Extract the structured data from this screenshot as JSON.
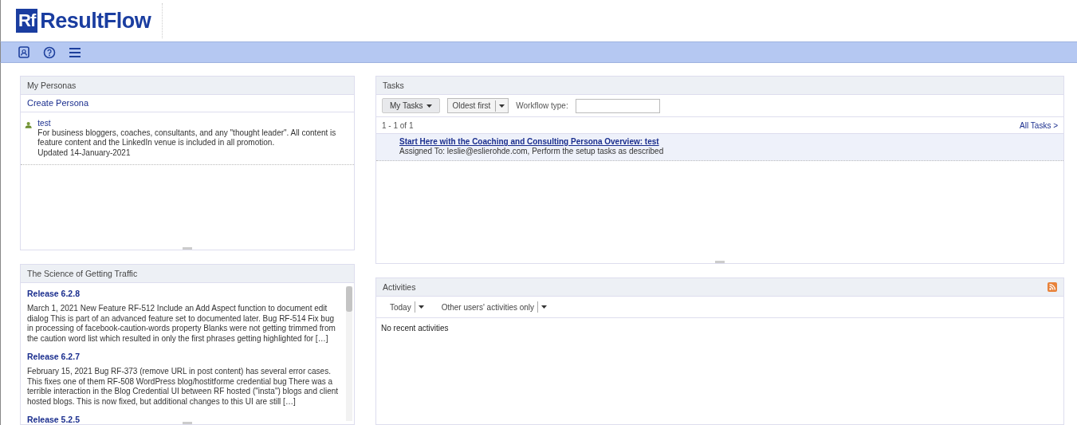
{
  "header": {
    "logo_mark": "Rf",
    "logo_text": "ResultFlow"
  },
  "toolbar": {
    "icons": [
      {
        "kind": "account"
      },
      {
        "kind": "help"
      },
      {
        "kind": "menu"
      }
    ]
  },
  "personas": {
    "title": "My Personas",
    "create_link": "Create Persona",
    "items": [
      {
        "name": "test",
        "description": "For business bloggers, coaches, consultants, and any \"thought leader\". All content is feature content and the LinkedIn venue is included in all promotion.",
        "updated": "Updated 14-January-2021"
      }
    ]
  },
  "news": {
    "title": "The Science of Getting Traffic",
    "posts": [
      {
        "title": "Release 6.2.8",
        "body": "March 1, 2021 New Feature RF-512 Include an Add Aspect function to document edit dialog This is part of an advanced feature set to documented later. Bug RF-514 Fix bug in processing of facebook-caution-words property Blanks were not getting trimmed from the caution word list which resulted in only the first phrases getting highlighted for […]"
      },
      {
        "title": "Release 6.2.7",
        "body": "February 15, 2021 Bug RF-373 (remove URL in post content) has several error cases. This fixes one of them RF-508 WordPress blog/hostitforme credential bug There was a terrible interaction in the Blog Credential UI between RF hosted (\"insta\") blogs and client hosted blogs. This is now fixed, but additional changes to this UI are still […]"
      },
      {
        "title": "Release 5.2.5"
      }
    ]
  },
  "tasks": {
    "title": "Tasks",
    "filter": "My Tasks",
    "sort": "Oldest first",
    "workflow_label": "Workflow type:",
    "count": "1 - 1 of 1",
    "all_link": "All Tasks >",
    "rows": [
      {
        "title": "Start Here with the Coaching and Consulting Persona Overview: test",
        "detail": "Assigned To: leslie@eslierohde.com, Perform the setup tasks as described",
        "selected": true
      }
    ]
  },
  "activities": {
    "title": "Activities",
    "period": "Today",
    "scope": "Other users' activities only",
    "empty": "No recent activities"
  }
}
